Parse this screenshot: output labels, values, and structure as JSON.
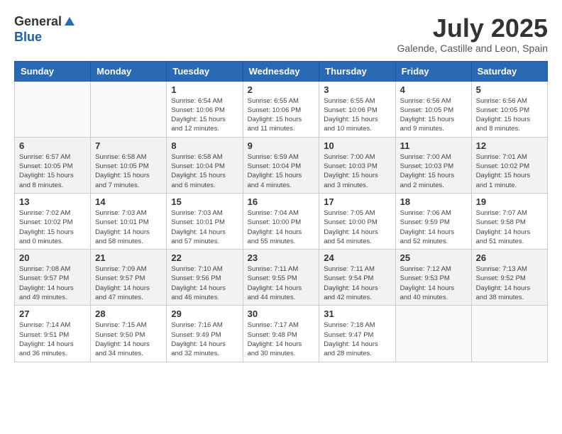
{
  "header": {
    "logo_general": "General",
    "logo_blue": "Blue",
    "month_year": "July 2025",
    "location": "Galende, Castille and Leon, Spain"
  },
  "weekdays": [
    "Sunday",
    "Monday",
    "Tuesday",
    "Wednesday",
    "Thursday",
    "Friday",
    "Saturday"
  ],
  "weeks": [
    [
      {
        "day": "",
        "info": ""
      },
      {
        "day": "",
        "info": ""
      },
      {
        "day": "1",
        "info": "Sunrise: 6:54 AM\nSunset: 10:06 PM\nDaylight: 15 hours\nand 12 minutes."
      },
      {
        "day": "2",
        "info": "Sunrise: 6:55 AM\nSunset: 10:06 PM\nDaylight: 15 hours\nand 11 minutes."
      },
      {
        "day": "3",
        "info": "Sunrise: 6:55 AM\nSunset: 10:06 PM\nDaylight: 15 hours\nand 10 minutes."
      },
      {
        "day": "4",
        "info": "Sunrise: 6:56 AM\nSunset: 10:05 PM\nDaylight: 15 hours\nand 9 minutes."
      },
      {
        "day": "5",
        "info": "Sunrise: 6:56 AM\nSunset: 10:05 PM\nDaylight: 15 hours\nand 8 minutes."
      }
    ],
    [
      {
        "day": "6",
        "info": "Sunrise: 6:57 AM\nSunset: 10:05 PM\nDaylight: 15 hours\nand 8 minutes."
      },
      {
        "day": "7",
        "info": "Sunrise: 6:58 AM\nSunset: 10:05 PM\nDaylight: 15 hours\nand 7 minutes."
      },
      {
        "day": "8",
        "info": "Sunrise: 6:58 AM\nSunset: 10:04 PM\nDaylight: 15 hours\nand 6 minutes."
      },
      {
        "day": "9",
        "info": "Sunrise: 6:59 AM\nSunset: 10:04 PM\nDaylight: 15 hours\nand 4 minutes."
      },
      {
        "day": "10",
        "info": "Sunrise: 7:00 AM\nSunset: 10:03 PM\nDaylight: 15 hours\nand 3 minutes."
      },
      {
        "day": "11",
        "info": "Sunrise: 7:00 AM\nSunset: 10:03 PM\nDaylight: 15 hours\nand 2 minutes."
      },
      {
        "day": "12",
        "info": "Sunrise: 7:01 AM\nSunset: 10:02 PM\nDaylight: 15 hours\nand 1 minute."
      }
    ],
    [
      {
        "day": "13",
        "info": "Sunrise: 7:02 AM\nSunset: 10:02 PM\nDaylight: 15 hours\nand 0 minutes."
      },
      {
        "day": "14",
        "info": "Sunrise: 7:03 AM\nSunset: 10:01 PM\nDaylight: 14 hours\nand 58 minutes."
      },
      {
        "day": "15",
        "info": "Sunrise: 7:03 AM\nSunset: 10:01 PM\nDaylight: 14 hours\nand 57 minutes."
      },
      {
        "day": "16",
        "info": "Sunrise: 7:04 AM\nSunset: 10:00 PM\nDaylight: 14 hours\nand 55 minutes."
      },
      {
        "day": "17",
        "info": "Sunrise: 7:05 AM\nSunset: 10:00 PM\nDaylight: 14 hours\nand 54 minutes."
      },
      {
        "day": "18",
        "info": "Sunrise: 7:06 AM\nSunset: 9:59 PM\nDaylight: 14 hours\nand 52 minutes."
      },
      {
        "day": "19",
        "info": "Sunrise: 7:07 AM\nSunset: 9:58 PM\nDaylight: 14 hours\nand 51 minutes."
      }
    ],
    [
      {
        "day": "20",
        "info": "Sunrise: 7:08 AM\nSunset: 9:57 PM\nDaylight: 14 hours\nand 49 minutes."
      },
      {
        "day": "21",
        "info": "Sunrise: 7:09 AM\nSunset: 9:57 PM\nDaylight: 14 hours\nand 47 minutes."
      },
      {
        "day": "22",
        "info": "Sunrise: 7:10 AM\nSunset: 9:56 PM\nDaylight: 14 hours\nand 46 minutes."
      },
      {
        "day": "23",
        "info": "Sunrise: 7:11 AM\nSunset: 9:55 PM\nDaylight: 14 hours\nand 44 minutes."
      },
      {
        "day": "24",
        "info": "Sunrise: 7:11 AM\nSunset: 9:54 PM\nDaylight: 14 hours\nand 42 minutes."
      },
      {
        "day": "25",
        "info": "Sunrise: 7:12 AM\nSunset: 9:53 PM\nDaylight: 14 hours\nand 40 minutes."
      },
      {
        "day": "26",
        "info": "Sunrise: 7:13 AM\nSunset: 9:52 PM\nDaylight: 14 hours\nand 38 minutes."
      }
    ],
    [
      {
        "day": "27",
        "info": "Sunrise: 7:14 AM\nSunset: 9:51 PM\nDaylight: 14 hours\nand 36 minutes."
      },
      {
        "day": "28",
        "info": "Sunrise: 7:15 AM\nSunset: 9:50 PM\nDaylight: 14 hours\nand 34 minutes."
      },
      {
        "day": "29",
        "info": "Sunrise: 7:16 AM\nSunset: 9:49 PM\nDaylight: 14 hours\nand 32 minutes."
      },
      {
        "day": "30",
        "info": "Sunrise: 7:17 AM\nSunset: 9:48 PM\nDaylight: 14 hours\nand 30 minutes."
      },
      {
        "day": "31",
        "info": "Sunrise: 7:18 AM\nSunset: 9:47 PM\nDaylight: 14 hours\nand 28 minutes."
      },
      {
        "day": "",
        "info": ""
      },
      {
        "day": "",
        "info": ""
      }
    ]
  ]
}
